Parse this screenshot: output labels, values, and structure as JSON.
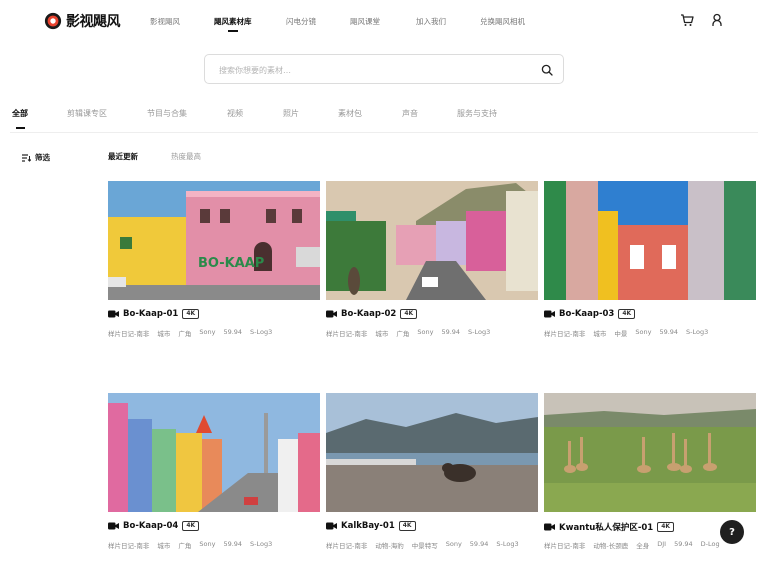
{
  "brand": {
    "logo_text": "影视飓风"
  },
  "nav": {
    "items": [
      {
        "label": "影视飓风",
        "active": false
      },
      {
        "label": "飓风素材库",
        "active": true
      },
      {
        "label": "闪电分镜",
        "active": false
      },
      {
        "label": "飓风课堂",
        "active": false
      },
      {
        "label": "加入我们",
        "active": false
      },
      {
        "label": "兑换飓风相机",
        "active": false
      }
    ]
  },
  "header_icons": [
    "cart-icon",
    "user-icon"
  ],
  "search": {
    "placeholder": "搜索你想要的素材…",
    "value": ""
  },
  "tabs": [
    {
      "label": "全部",
      "active": true
    },
    {
      "label": "剪辑课专区",
      "active": false
    },
    {
      "label": "节目与合集",
      "active": false
    },
    {
      "label": "视频",
      "active": false
    },
    {
      "label": "照片",
      "active": false
    },
    {
      "label": "素材包",
      "active": false
    },
    {
      "label": "声音",
      "active": false
    },
    {
      "label": "服务与支持",
      "active": false
    }
  ],
  "filter": {
    "label": "筛选",
    "icon": "filter-icon"
  },
  "sort": [
    {
      "label": "最近更新",
      "active": true
    },
    {
      "label": "热度最高",
      "active": false
    }
  ],
  "cards": [
    {
      "title": "Bo-Kaap-01",
      "badge": "4K",
      "tags": [
        "样片日记-南非",
        "城市",
        "广角",
        "Sony",
        "59.94",
        "S-Log3"
      ],
      "scene": "street"
    },
    {
      "title": "Bo-Kaap-02",
      "badge": "4K",
      "tags": [
        "样片日记-南非",
        "城市",
        "广角",
        "Sony",
        "59.94",
        "S-Log3"
      ],
      "scene": "hill"
    },
    {
      "title": "Bo-Kaap-03",
      "badge": "4K",
      "tags": [
        "样片日记-南非",
        "城市",
        "中景",
        "Sony",
        "59.94",
        "S-Log3"
      ],
      "scene": "window"
    },
    {
      "title": "Bo-Kaap-04",
      "badge": "4K",
      "tags": [
        "样片日记-南非",
        "城市",
        "广角",
        "Sony",
        "59.94",
        "S-Log3"
      ],
      "scene": "lane"
    },
    {
      "title": "KalkBay-01",
      "badge": "4K",
      "tags": [
        "样片日记-南非",
        "动物-海豹",
        "中景特写",
        "Sony",
        "59.94",
        "S-Log3"
      ],
      "scene": "seal"
    },
    {
      "title": "Kwantu私人保护区-01",
      "badge": "4K",
      "tags": [
        "样片日记-南非",
        "动物-长颈鹿",
        "全身",
        "DJI",
        "59.94",
        "D-Log"
      ],
      "scene": "giraffe"
    }
  ],
  "help": {
    "label": "?"
  },
  "colors": {
    "accent": "#111111",
    "muted": "#999999"
  }
}
